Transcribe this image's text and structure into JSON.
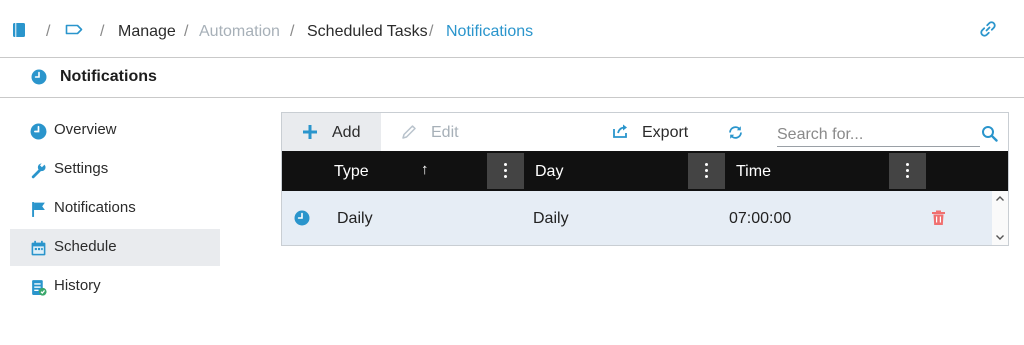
{
  "breadcrumb": {
    "items": [
      "Manage",
      "Automation",
      "Scheduled Tasks",
      "Notifications"
    ],
    "separator": "/"
  },
  "header": {
    "title": "Notifications"
  },
  "sidebar": {
    "items": [
      {
        "label": "Overview",
        "icon": "clock-icon"
      },
      {
        "label": "Settings",
        "icon": "wrench-icon"
      },
      {
        "label": "Notifications",
        "icon": "flag-icon"
      },
      {
        "label": "Schedule",
        "icon": "calendar-icon",
        "selected": true
      },
      {
        "label": "History",
        "icon": "history-icon"
      }
    ]
  },
  "toolbar": {
    "add_label": "Add",
    "edit_label": "Edit",
    "export_label": "Export",
    "search_placeholder": "Search for..."
  },
  "table": {
    "columns": [
      "Type",
      "Day",
      "Time"
    ],
    "sort_indicator": "↑",
    "rows": [
      {
        "type": "Daily",
        "day": "Daily",
        "time": "07:00:00"
      }
    ]
  },
  "colors": {
    "accent": "#2a95cc",
    "header_bg": "#111111",
    "row_selected": "#e6edf5",
    "delete": "#f07070",
    "add": "#2a95cc"
  }
}
